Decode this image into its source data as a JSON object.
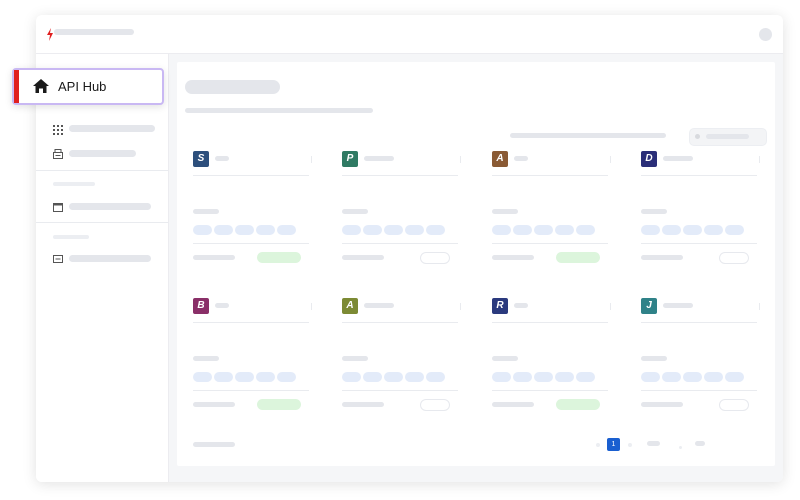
{
  "brand": {
    "name": "API Hub",
    "accent": "#e02020",
    "highlight_border": "#c9b8f3"
  },
  "nav": {
    "home_icon": "home-icon",
    "home_label": "API Hub"
  },
  "pagination": {
    "current_page": "1",
    "current_color": "#1a5fd0"
  },
  "cards": [
    {
      "letter": "S",
      "color": "#2d4f7c",
      "status": "green"
    },
    {
      "letter": "P",
      "color": "#2f7a63",
      "status": "white"
    },
    {
      "letter": "A",
      "color": "#8a5a34",
      "status": "green"
    },
    {
      "letter": "D",
      "color": "#2a2e78",
      "status": "white"
    },
    {
      "letter": "B",
      "color": "#8a2f68",
      "status": "green"
    },
    {
      "letter": "A",
      "color": "#7c8a34",
      "status": "white"
    },
    {
      "letter": "R",
      "color": "#2b3a7e",
      "status": "green"
    },
    {
      "letter": "J",
      "color": "#2f8288",
      "status": "white"
    }
  ]
}
